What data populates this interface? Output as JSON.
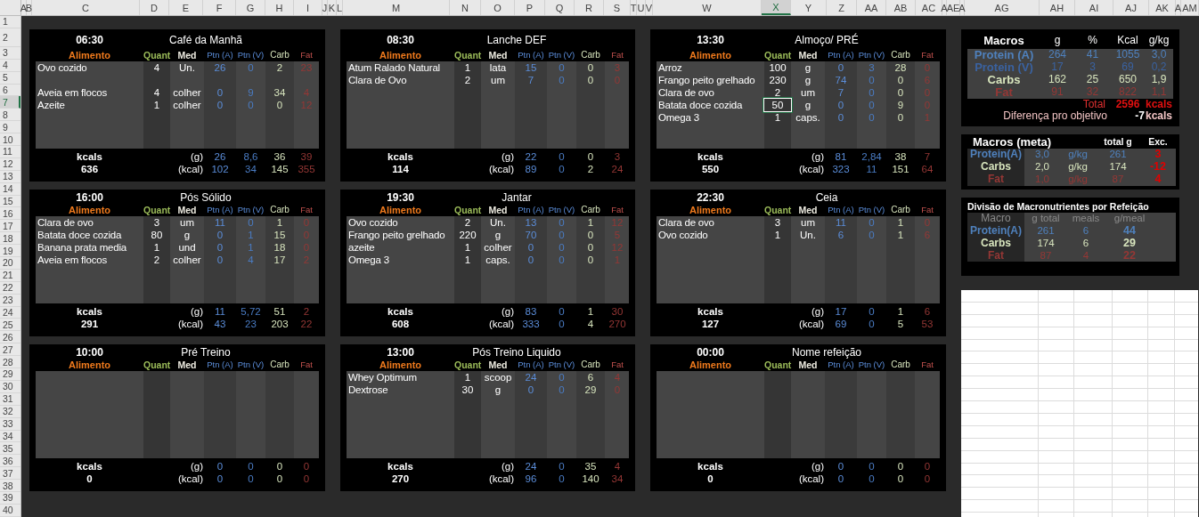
{
  "columns": [
    {
      "label": "A",
      "selected": false
    },
    {
      "label": "B",
      "selected": false
    },
    {
      "label": "C",
      "selected": false
    },
    {
      "label": "D",
      "selected": false
    },
    {
      "label": "E",
      "selected": false
    },
    {
      "label": "F",
      "selected": false
    },
    {
      "label": "G",
      "selected": false
    },
    {
      "label": "H",
      "selected": false
    },
    {
      "label": "I",
      "selected": false
    },
    {
      "label": "J",
      "selected": false
    },
    {
      "label": "K",
      "selected": false
    },
    {
      "label": "L",
      "selected": false
    },
    {
      "label": "M",
      "selected": false
    },
    {
      "label": "N",
      "selected": false
    },
    {
      "label": "O",
      "selected": false
    },
    {
      "label": "P",
      "selected": false
    },
    {
      "label": "Q",
      "selected": false
    },
    {
      "label": "R",
      "selected": false
    },
    {
      "label": "S",
      "selected": false
    },
    {
      "label": "T",
      "selected": false
    },
    {
      "label": "U",
      "selected": false
    },
    {
      "label": "V",
      "selected": false
    },
    {
      "label": "W",
      "selected": false
    },
    {
      "label": "X",
      "selected": true
    },
    {
      "label": "Y",
      "selected": false
    },
    {
      "label": "Z",
      "selected": false
    },
    {
      "label": "AA",
      "selected": false
    },
    {
      "label": "AB",
      "selected": false
    },
    {
      "label": "AC",
      "selected": false
    },
    {
      "label": "A",
      "selected": false
    },
    {
      "label": "AE",
      "selected": false
    },
    {
      "label": "A",
      "selected": false
    },
    {
      "label": "AG",
      "selected": false
    },
    {
      "label": "AH",
      "selected": false
    },
    {
      "label": "AI",
      "selected": false
    },
    {
      "label": "AJ",
      "selected": false
    },
    {
      "label": "AK",
      "selected": false
    },
    {
      "label": "A",
      "selected": false
    },
    {
      "label": "AM",
      "selected": false
    }
  ],
  "rows": [
    {
      "label": "1",
      "selected": false
    },
    {
      "label": "2",
      "selected": false
    },
    {
      "label": "3",
      "selected": false
    },
    {
      "label": "4",
      "selected": false
    },
    {
      "label": "5",
      "selected": false
    },
    {
      "label": "6",
      "selected": false
    },
    {
      "label": "7",
      "selected": true
    },
    {
      "label": "8",
      "selected": false
    },
    {
      "label": "9",
      "selected": false
    },
    {
      "label": "10",
      "selected": false
    },
    {
      "label": "11",
      "selected": false
    },
    {
      "label": "12",
      "selected": false
    },
    {
      "label": "13",
      "selected": false
    },
    {
      "label": "14",
      "selected": false
    },
    {
      "label": "15",
      "selected": false
    },
    {
      "label": "16",
      "selected": false
    },
    {
      "label": "17",
      "selected": false
    },
    {
      "label": "18",
      "selected": false
    },
    {
      "label": "19",
      "selected": false
    },
    {
      "label": "20",
      "selected": false
    },
    {
      "label": "21",
      "selected": false
    },
    {
      "label": "22",
      "selected": false
    },
    {
      "label": "23",
      "selected": false
    },
    {
      "label": "24",
      "selected": false
    },
    {
      "label": "25",
      "selected": false
    },
    {
      "label": "26",
      "selected": false
    },
    {
      "label": "27",
      "selected": false
    },
    {
      "label": "28",
      "selected": false
    },
    {
      "label": "29",
      "selected": false
    },
    {
      "label": "30",
      "selected": false
    },
    {
      "label": "31",
      "selected": false
    },
    {
      "label": "32",
      "selected": false
    },
    {
      "label": "33",
      "selected": false
    },
    {
      "label": "34",
      "selected": false
    },
    {
      "label": "35",
      "selected": false
    },
    {
      "label": "36",
      "selected": false
    },
    {
      "label": "37",
      "selected": false
    },
    {
      "label": "38",
      "selected": false
    },
    {
      "label": "39",
      "selected": false
    },
    {
      "label": "40",
      "selected": false
    }
  ],
  "meals": [
    {
      "time": "06:30",
      "name": "Café da Manhã",
      "columns": [
        "Alimento",
        "Quant",
        "Med",
        "Ptn (A)",
        "Ptn (V)",
        "Carb",
        "Fat"
      ],
      "items": [
        {
          "kind": "food",
          "food": "Ovo cozido",
          "quant": "4",
          "med": "Un.",
          "values": [
            "26",
            "0",
            "2",
            "23"
          ],
          "selected": false
        },
        {
          "kind": "empty"
        },
        {
          "kind": "food",
          "food": "Aveia em flocos",
          "quant": "4",
          "med": "colher",
          "values": [
            "0",
            "9",
            "34",
            "4"
          ],
          "selected": false
        },
        {
          "kind": "food",
          "food": "Azeite",
          "quant": "1",
          "med": "colher",
          "values": [
            "0",
            "0",
            "0",
            "12"
          ],
          "selected": false
        }
      ],
      "totals": {
        "label": "kcals",
        "kcal_total": "636",
        "g_label": "(g)",
        "kcal_label": "(kcal)",
        "grams": [
          "26",
          "8,6",
          "36",
          "39"
        ],
        "kcal": [
          "102",
          "34",
          "145",
          "355"
        ]
      }
    },
    {
      "time": "08:30",
      "name": "Lanche DEF",
      "columns": [
        "Alimento",
        "Quant",
        "Med",
        "Ptn (A)",
        "Ptn (V)",
        "Carb",
        "Fat"
      ],
      "items": [
        {
          "kind": "food",
          "food": "Atum Ralado Natural",
          "quant": "1",
          "med": "lata",
          "values": [
            "15",
            "0",
            "0",
            "3"
          ],
          "selected": false
        },
        {
          "kind": "food",
          "food": "Clara de Ovo",
          "quant": "2",
          "med": "um",
          "values": [
            "7",
            "0",
            "0",
            "0"
          ],
          "selected": false
        }
      ],
      "totals": {
        "label": "kcals",
        "kcal_total": "114",
        "g_label": "(g)",
        "kcal_label": "(kcal)",
        "grams": [
          "22",
          "0",
          "0",
          "3"
        ],
        "kcal": [
          "89",
          "0",
          "2",
          "24"
        ]
      }
    },
    {
      "time": "13:30",
      "name": "Almoço/ PRÉ",
      "columns": [
        "Alimento",
        "Quant",
        "Med",
        "Ptn (A)",
        "Ptn (V)",
        "Carb",
        "Fat"
      ],
      "items": [
        {
          "kind": "food",
          "food": "Arroz",
          "quant": "100",
          "med": "g",
          "values": [
            "0",
            "3",
            "28",
            "0"
          ],
          "selected": false
        },
        {
          "kind": "food",
          "food": "Frango peito grelhado",
          "quant": "230",
          "med": "g",
          "values": [
            "74",
            "0",
            "0",
            "6"
          ],
          "selected": false
        },
        {
          "kind": "food",
          "food": "Clara de ovo",
          "quant": "2",
          "med": "um",
          "values": [
            "7",
            "0",
            "0",
            "0"
          ],
          "selected": false
        },
        {
          "kind": "food",
          "food": "Batata doce cozida",
          "quant": "50",
          "med": "g",
          "values": [
            "0",
            "0",
            "9",
            "0"
          ],
          "selected": true
        },
        {
          "kind": "food",
          "food": "Omega 3",
          "quant": "1",
          "med": "caps.",
          "values": [
            "0",
            "0",
            "0",
            "1"
          ],
          "selected": false
        }
      ],
      "totals": {
        "label": "kcals",
        "kcal_total": "550",
        "g_label": "(g)",
        "kcal_label": "(kcal)",
        "grams": [
          "81",
          "2,84",
          "38",
          "7"
        ],
        "kcal": [
          "323",
          "11",
          "151",
          "64"
        ]
      }
    },
    {
      "time": "16:00",
      "name": "Pós Sólido",
      "columns": [
        "Alimento",
        "Quant",
        "Med",
        "Ptn (A)",
        "Ptn (V)",
        "Carb",
        "Fat"
      ],
      "items": [
        {
          "kind": "food",
          "food": "Clara de ovo",
          "quant": "3",
          "med": "um",
          "values": [
            "11",
            "0",
            "1",
            "0"
          ],
          "selected": false
        },
        {
          "kind": "food",
          "food": "Batata doce cozida",
          "quant": "80",
          "med": "g",
          "values": [
            "0",
            "1",
            "15",
            "0"
          ],
          "selected": false
        },
        {
          "kind": "food",
          "food": "Banana prata media",
          "quant": "1",
          "med": "und",
          "values": [
            "0",
            "1",
            "18",
            "0"
          ],
          "selected": false
        },
        {
          "kind": "food",
          "food": "Aveia em flocos",
          "quant": "2",
          "med": "colher",
          "values": [
            "0",
            "4",
            "17",
            "2"
          ],
          "selected": false
        }
      ],
      "totals": {
        "label": "kcals",
        "kcal_total": "291",
        "g_label": "(g)",
        "kcal_label": "(kcal)",
        "grams": [
          "11",
          "5,72",
          "51",
          "2"
        ],
        "kcal": [
          "43",
          "23",
          "203",
          "22"
        ]
      }
    },
    {
      "time": "19:30",
      "name": "Jantar",
      "columns": [
        "Alimento",
        "Quant",
        "Med",
        "Ptn (A)",
        "Ptn (V)",
        "Carb",
        "Fat"
      ],
      "items": [
        {
          "kind": "food",
          "food": "Ovo cozido",
          "quant": "2",
          "med": "Un.",
          "values": [
            "13",
            "0",
            "1",
            "12"
          ],
          "selected": false
        },
        {
          "kind": "food",
          "food": "Frango peito grelhado",
          "quant": "220",
          "med": "g",
          "values": [
            "70",
            "0",
            "0",
            "5"
          ],
          "selected": false
        },
        {
          "kind": "food",
          "food": "azeite",
          "quant": "1",
          "med": "colher",
          "values": [
            "0",
            "0",
            "0",
            "12"
          ],
          "selected": false
        },
        {
          "kind": "food",
          "food": "Omega 3",
          "quant": "1",
          "med": "caps.",
          "values": [
            "0",
            "0",
            "0",
            "1"
          ],
          "selected": false
        }
      ],
      "totals": {
        "label": "kcals",
        "kcal_total": "608",
        "g_label": "(g)",
        "kcal_label": "(kcal)",
        "grams": [
          "83",
          "0",
          "1",
          "30"
        ],
        "kcal": [
          "333",
          "0",
          "4",
          "270"
        ]
      }
    },
    {
      "time": "22:30",
      "name": "Ceia",
      "columns": [
        "Alimento",
        "Quant",
        "Med",
        "Ptn (A)",
        "Ptn (V)",
        "Carb",
        "Fat"
      ],
      "items": [
        {
          "kind": "food",
          "food": "Clara de ovo",
          "quant": "3",
          "med": "um",
          "values": [
            "11",
            "0",
            "1",
            "0"
          ],
          "selected": false
        },
        {
          "kind": "food",
          "food": "Ovo cozido",
          "quant": "1",
          "med": "Un.",
          "values": [
            "6",
            "0",
            "1",
            "6"
          ],
          "selected": false
        }
      ],
      "totals": {
        "label": "kcals",
        "kcal_total": "127",
        "g_label": "(g)",
        "kcal_label": "(kcal)",
        "grams": [
          "17",
          "0",
          "1",
          "6"
        ],
        "kcal": [
          "69",
          "0",
          "5",
          "53"
        ]
      }
    },
    {
      "time": "10:00",
      "name": "Pré Treino",
      "columns": [
        "Alimento",
        "Quant",
        "Med",
        "Ptn (A)",
        "Ptn (V)",
        "Carb",
        "Fat"
      ],
      "totals": {
        "label": "kcals",
        "kcal_total": "0",
        "g_label": "(g)",
        "kcal_label": "(kcal)",
        "grams": [
          "0",
          "0",
          "0",
          "0"
        ],
        "kcal": [
          "0",
          "0",
          "0",
          "0"
        ]
      }
    },
    {
      "time": "13:00",
      "name": "Pós Treino Liquido",
      "columns": [
        "Alimento",
        "Quant",
        "Med",
        "Ptn (A)",
        "Ptn (V)",
        "Carb",
        "Fat"
      ],
      "items": [
        {
          "kind": "food",
          "food": "Whey Optimum",
          "quant": "1",
          "med": "scoop",
          "values": [
            "24",
            "0",
            "6",
            "4"
          ],
          "selected": false
        },
        {
          "kind": "food",
          "food": "Dextrose",
          "quant": "30",
          "med": "g",
          "values": [
            "0",
            "0",
            "29",
            "0"
          ],
          "selected": false
        }
      ],
      "totals": {
        "label": "kcals",
        "kcal_total": "270",
        "g_label": "(g)",
        "kcal_label": "(kcal)",
        "grams": [
          "24",
          "0",
          "35",
          "4"
        ],
        "kcal": [
          "96",
          "0",
          "140",
          "34"
        ]
      }
    },
    {
      "time": "00:00",
      "name": "Nome refeição",
      "columns": [
        "Alimento",
        "Quant",
        "Med",
        "Ptn (A)",
        "Ptn (V)",
        "Carb",
        "Fat"
      ],
      "totals": {
        "label": "kcals",
        "kcal_total": "0",
        "g_label": "(g)",
        "kcal_label": "(kcal)",
        "grams": [
          "0",
          "0",
          "0",
          "0"
        ],
        "kcal": [
          "0",
          "0",
          "0",
          "0"
        ]
      }
    }
  ],
  "macros": {
    "title": "Macros",
    "columns": [
      "g",
      "%",
      "Kcal",
      "g/kg"
    ],
    "rows": [
      {
        "label": "Protein (A)",
        "kind": "protein",
        "values": [
          "264",
          "41",
          "1055",
          "3,0"
        ]
      },
      {
        "label": "Protein (V)",
        "kind": "vegetal",
        "values": [
          "17",
          "3",
          "69",
          "0,2"
        ]
      },
      {
        "label": "Carbs",
        "kind": "carbs",
        "values": [
          "162",
          "25",
          "650",
          "1,9"
        ]
      },
      {
        "label": "Fat",
        "kind": "fat",
        "values": [
          "91",
          "32",
          "822",
          "1,1"
        ]
      }
    ],
    "total": {
      "label": "Total",
      "value": "2596",
      "unit": "kcals"
    },
    "difference": {
      "label": "Diferença pro objetivo",
      "value": "-7",
      "unit": "kcals"
    }
  },
  "targets": {
    "title": "Macros (meta)",
    "columns": [
      "total g",
      "Exc."
    ],
    "rows": [
      {
        "label": "Protein(A)",
        "kind": "protein",
        "ratio": "3,0",
        "unit": "g/kg",
        "total": "261",
        "excess": "3"
      },
      {
        "label": "Carbs",
        "kind": "carbs",
        "ratio": "2,0",
        "unit": "g/kg",
        "total": "174",
        "excess": "-12"
      },
      {
        "label": "Fat",
        "kind": "fat",
        "ratio": "1,0",
        "unit": "g/kg",
        "total": "87",
        "excess": "4"
      }
    ]
  },
  "division": {
    "title": "Divisão de Macronutrientes por Refeição",
    "columns": [
      "Macro",
      "g total",
      "meals",
      "g/meal"
    ],
    "rows": [
      {
        "label": "Protein(A)",
        "kind": "protein",
        "total": "261",
        "meals": "6",
        "per_meal": "44"
      },
      {
        "label": "Carbs",
        "kind": "carbs",
        "total": "174",
        "meals": "6",
        "per_meal": "29"
      },
      {
        "label": "Fat",
        "kind": "fat",
        "total": "87",
        "meals": "4",
        "per_meal": "22"
      }
    ]
  }
}
